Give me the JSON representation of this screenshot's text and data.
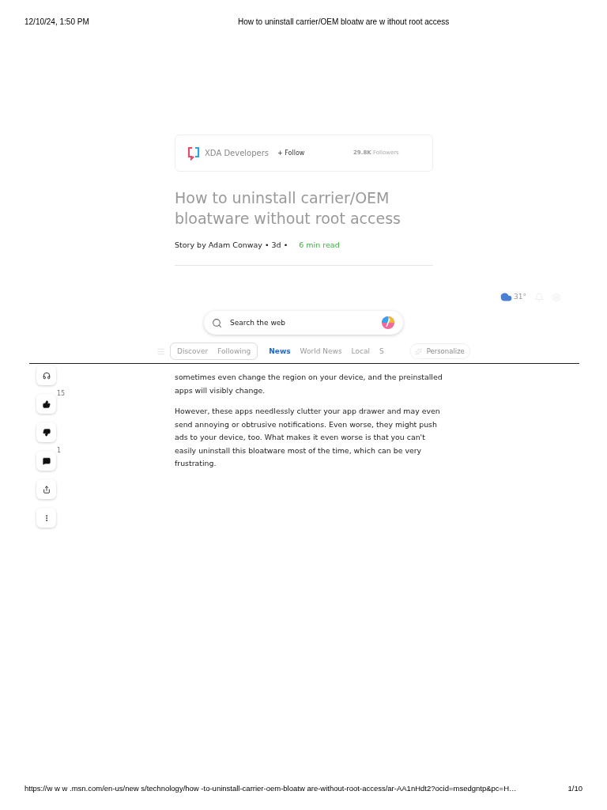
{
  "print_header": {
    "date": "12/10/24, 1:50 PM",
    "title": "How  to uninstall carrier/OEM bloatw are w ithout root access"
  },
  "publisher": {
    "name": "XDA Developers",
    "follow": "+ Follow",
    "followers_count": "29.8K",
    "followers_label": "Followers"
  },
  "article": {
    "title": "How to uninstall carrier/OEM bloatware without root access",
    "byline": "Story by Adam Conway • 3d •",
    "read_time": "6 min read",
    "paragraphs": [
      "sometimes even change the region on your device, and the preinstalled apps will visibly change.",
      "However, these apps needlessly clutter your app drawer and may even send annoying or obtrusive notifications. Even worse, they might push ads to your device, too. What makes it even worse is that you can't easily uninstall this bloatware most of the time, which can be very frustrating."
    ]
  },
  "weather": {
    "temperature": "31°"
  },
  "search": {
    "placeholder": "Search the web"
  },
  "feed_tabs": [
    {
      "label": "Discover",
      "selected": false,
      "kind": "grouped"
    },
    {
      "label": "Following",
      "selected": false,
      "kind": "grouped"
    },
    {
      "label": "News",
      "selected": true,
      "kind": "plain"
    },
    {
      "label": "World News",
      "selected": false,
      "kind": "plain"
    },
    {
      "label": "Local",
      "selected": false,
      "kind": "plain"
    },
    {
      "label": "S",
      "selected": false,
      "kind": "plain"
    }
  ],
  "personalize": "Personalize",
  "side_actions": [
    {
      "kind": "listen"
    },
    {
      "kind": "like",
      "count": "15"
    },
    {
      "kind": "dislike"
    },
    {
      "kind": "comment",
      "count": "1"
    },
    {
      "kind": "share"
    },
    {
      "kind": "more"
    }
  ],
  "print_footer": {
    "url": "https://w w w .msn.com/en-us/new s/technology/how -to-uninstall-carrier-oem-bloatw are-without-root-access/ar-AA1nHdt2?ocid=msedgntp&pc=H…",
    "page": "1/10"
  }
}
